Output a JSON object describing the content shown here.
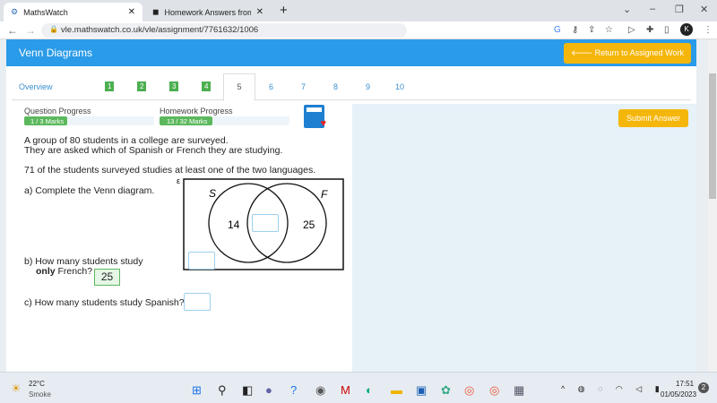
{
  "browser": {
    "tabs": [
      {
        "title": "MathsWatch"
      },
      {
        "title": "Homework Answers from Subject"
      }
    ],
    "url": "vle.mathswatch.co.uk/vle/assignment/7761632/1006",
    "profile_initial": "K"
  },
  "page": {
    "title": "Venn Diagrams",
    "return_label": "Return to Assigned Work",
    "overview_label": "Overview",
    "questions": [
      {
        "n": "1",
        "done": true
      },
      {
        "n": "2",
        "done": true
      },
      {
        "n": "3",
        "done": true
      },
      {
        "n": "4",
        "done": true
      },
      {
        "n": "5",
        "current": true
      },
      {
        "n": "6"
      },
      {
        "n": "7"
      },
      {
        "n": "8"
      },
      {
        "n": "9"
      },
      {
        "n": "10"
      }
    ],
    "question_progress": {
      "label": "Question Progress",
      "text": "1 / 3 Marks",
      "fraction": 0.333
    },
    "homework_progress": {
      "label": "Homework Progress",
      "text": "13 / 32 Marks",
      "fraction": 0.406
    },
    "submit_label": "Submit Answer",
    "intro1": "A group of 80 students in a college are surveyed.",
    "intro2": "They are asked which of Spanish or French they are studying.",
    "intro3": "71 of the students surveyed studies at least one of the two languages.",
    "qa": "a) Complete the Venn diagram.",
    "qb1": "b) How many students study",
    "qb_bold": "only",
    "qb2": "French?",
    "qb_answer": "25",
    "qc": "c) How many students study Spanish?",
    "venn": {
      "universal": "ε",
      "set_a": "S",
      "set_b": "F",
      "only_a": "14",
      "only_b": "25"
    }
  },
  "taskbar": {
    "temp": "22°C",
    "weather": "Smoke",
    "time": "17:51",
    "date": "01/05/2023",
    "notif": "2"
  }
}
